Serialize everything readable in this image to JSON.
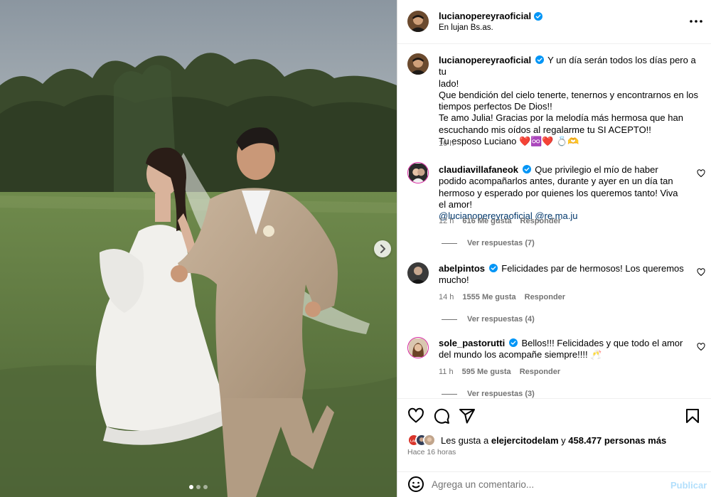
{
  "post": {
    "author": "lucianopereyraoficial",
    "location": "En lujan Bs.as.",
    "caption_lines": [
      "Y un día serán todos los días pero a tu",
      "lado!",
      "Que bendición del cielo tenerte, tenernos y encontrarnos en los",
      "tiempos perfectos De Dios!!",
      "Te amo Julia! Gracias por la melodía más hermosa que han",
      "escuchando mis oídos al regalarme tu SI ACEPTO!!",
      "Tu esposo Luciano ❤️♾️❤️ 💍🫶"
    ],
    "caption_time": "16 h",
    "carousel": {
      "slide_count": 3,
      "active_index": 0
    }
  },
  "comments": [
    {
      "user": "claudiavillafaneok",
      "text": "Que privilegio el mío de haber podido acompañarlos antes, durante y ayer en un día tan hermoso y esperado por quienes los queremos tanto! Viva el amor!",
      "mentions": "@lucianopereyraoficial @re.ma.ju",
      "time": "12 h",
      "likes": "616 Me gusta",
      "reply": "Responder",
      "view_replies": "Ver respuestas (7)"
    },
    {
      "user": "abelpintos",
      "text": "Felicidades par de hermosos! Los queremos mucho!",
      "mentions": "",
      "time": "14 h",
      "likes": "1555 Me gusta",
      "reply": "Responder",
      "view_replies": "Ver respuestas (4)"
    },
    {
      "user": "sole_pastorutti",
      "text": "Bellos!!! Felicidades y que todo el amor del mundo los acompañe siempre!!!! 🥂",
      "mentions": "",
      "time": "11 h",
      "likes": "595 Me gusta",
      "reply": "Responder",
      "view_replies": "Ver respuestas (3)"
    }
  ],
  "likes": {
    "prefix": "Les gusta a",
    "user": "elejercitodelam",
    "middle": "y",
    "count": "458.477 personas más",
    "mini_avatar_text": "LAM"
  },
  "ago": "Hace 16 horas",
  "add_comment": {
    "placeholder": "Agrega un comentario...",
    "publish": "Publicar"
  },
  "colors": {
    "verified": "#0095f6",
    "link": "#00376b",
    "muted": "#737373",
    "publish_disabled": "#b2dffc"
  },
  "icons": [
    "chevron-right-icon",
    "more-icon",
    "verified-icon",
    "heart-icon",
    "comment-icon",
    "share-icon",
    "bookmark-icon",
    "emoji-icon"
  ]
}
